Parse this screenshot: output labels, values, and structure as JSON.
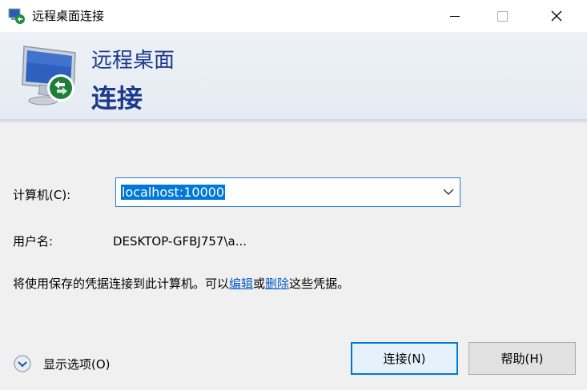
{
  "window": {
    "title": "远程桌面连接",
    "minimize_icon": "minimize-icon",
    "maximize_icon": "maximize-icon",
    "close_icon": "close-icon"
  },
  "banner": {
    "line1": "远程桌面",
    "line2": "连接",
    "accent_color": "#1c3a8a"
  },
  "form": {
    "computer_label": "计算机(C):",
    "computer_value": "localhost:10000",
    "user_label": "用户名:",
    "user_value": "DESKTOP-GFBJ757\\a...",
    "info_prefix": "将使用保存的凭据连接到此计算机。可以",
    "edit_link": "编辑",
    "info_or": "或",
    "delete_link": "删除",
    "info_suffix": "这些凭据。"
  },
  "footer": {
    "options_label": "显示选项(O)",
    "connect_label": "连接(N)",
    "help_label": "帮助(H)"
  }
}
